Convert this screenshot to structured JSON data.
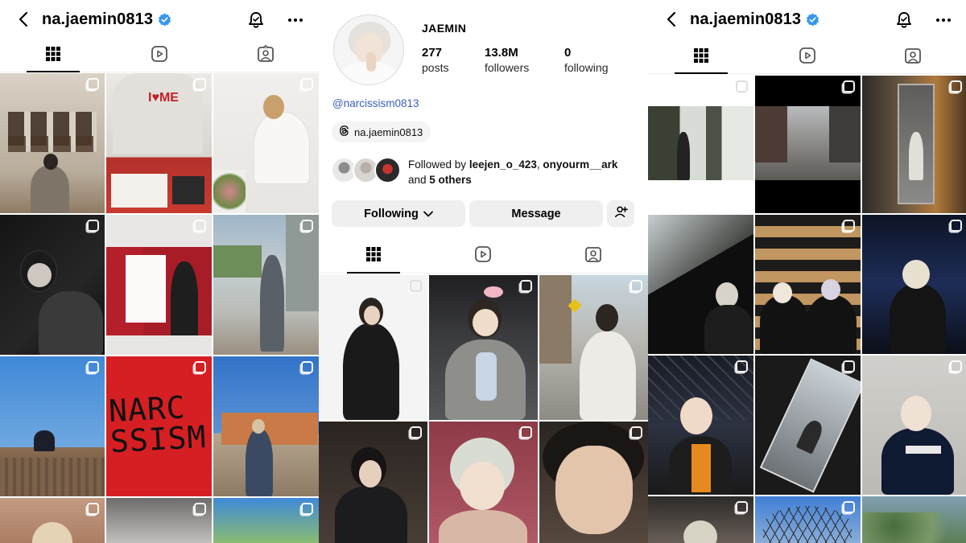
{
  "left_panel": {
    "username": "na.jaemin0813",
    "icons": [
      "back-icon",
      "verified-badge-icon",
      "notification-bell-icon",
      "more-options-icon"
    ],
    "tabs": [
      {
        "name": "posts-grid",
        "icon": "grid-icon",
        "active": true
      },
      {
        "name": "reels",
        "icon": "reels-icon",
        "active": false
      },
      {
        "name": "tagged",
        "icon": "tagged-icon",
        "active": false
      }
    ],
    "post_count_visible": 12
  },
  "middle_panel": {
    "display_name": "JAEMIN",
    "stats": [
      {
        "value": "277",
        "label": "posts"
      },
      {
        "value": "13.8M",
        "label": "followers"
      },
      {
        "value": "0",
        "label": "following"
      }
    ],
    "bio_link": "@narcissism0813",
    "threads_handle": "na.jaemin0813",
    "followed_by": {
      "prefix": "Followed by",
      "user1": "leejen_o_423",
      "separator": ",",
      "user2": "onyourm__ark",
      "and_text": "and",
      "others": "5 others"
    },
    "buttons": {
      "following": "Following",
      "message": "Message"
    },
    "icons": [
      "chevron-down-icon",
      "add-person-icon",
      "threads-icon"
    ]
  },
  "right_panel": {
    "username": "na.jaemin0813",
    "icons": [
      "back-icon",
      "verified-badge-icon",
      "notification-bell-icon",
      "more-options-icon"
    ]
  },
  "colors": {
    "verified_blue": "#3897f0",
    "link_blue": "#3b5fbf",
    "button_gray": "#efefef",
    "divider": "#efefef"
  }
}
